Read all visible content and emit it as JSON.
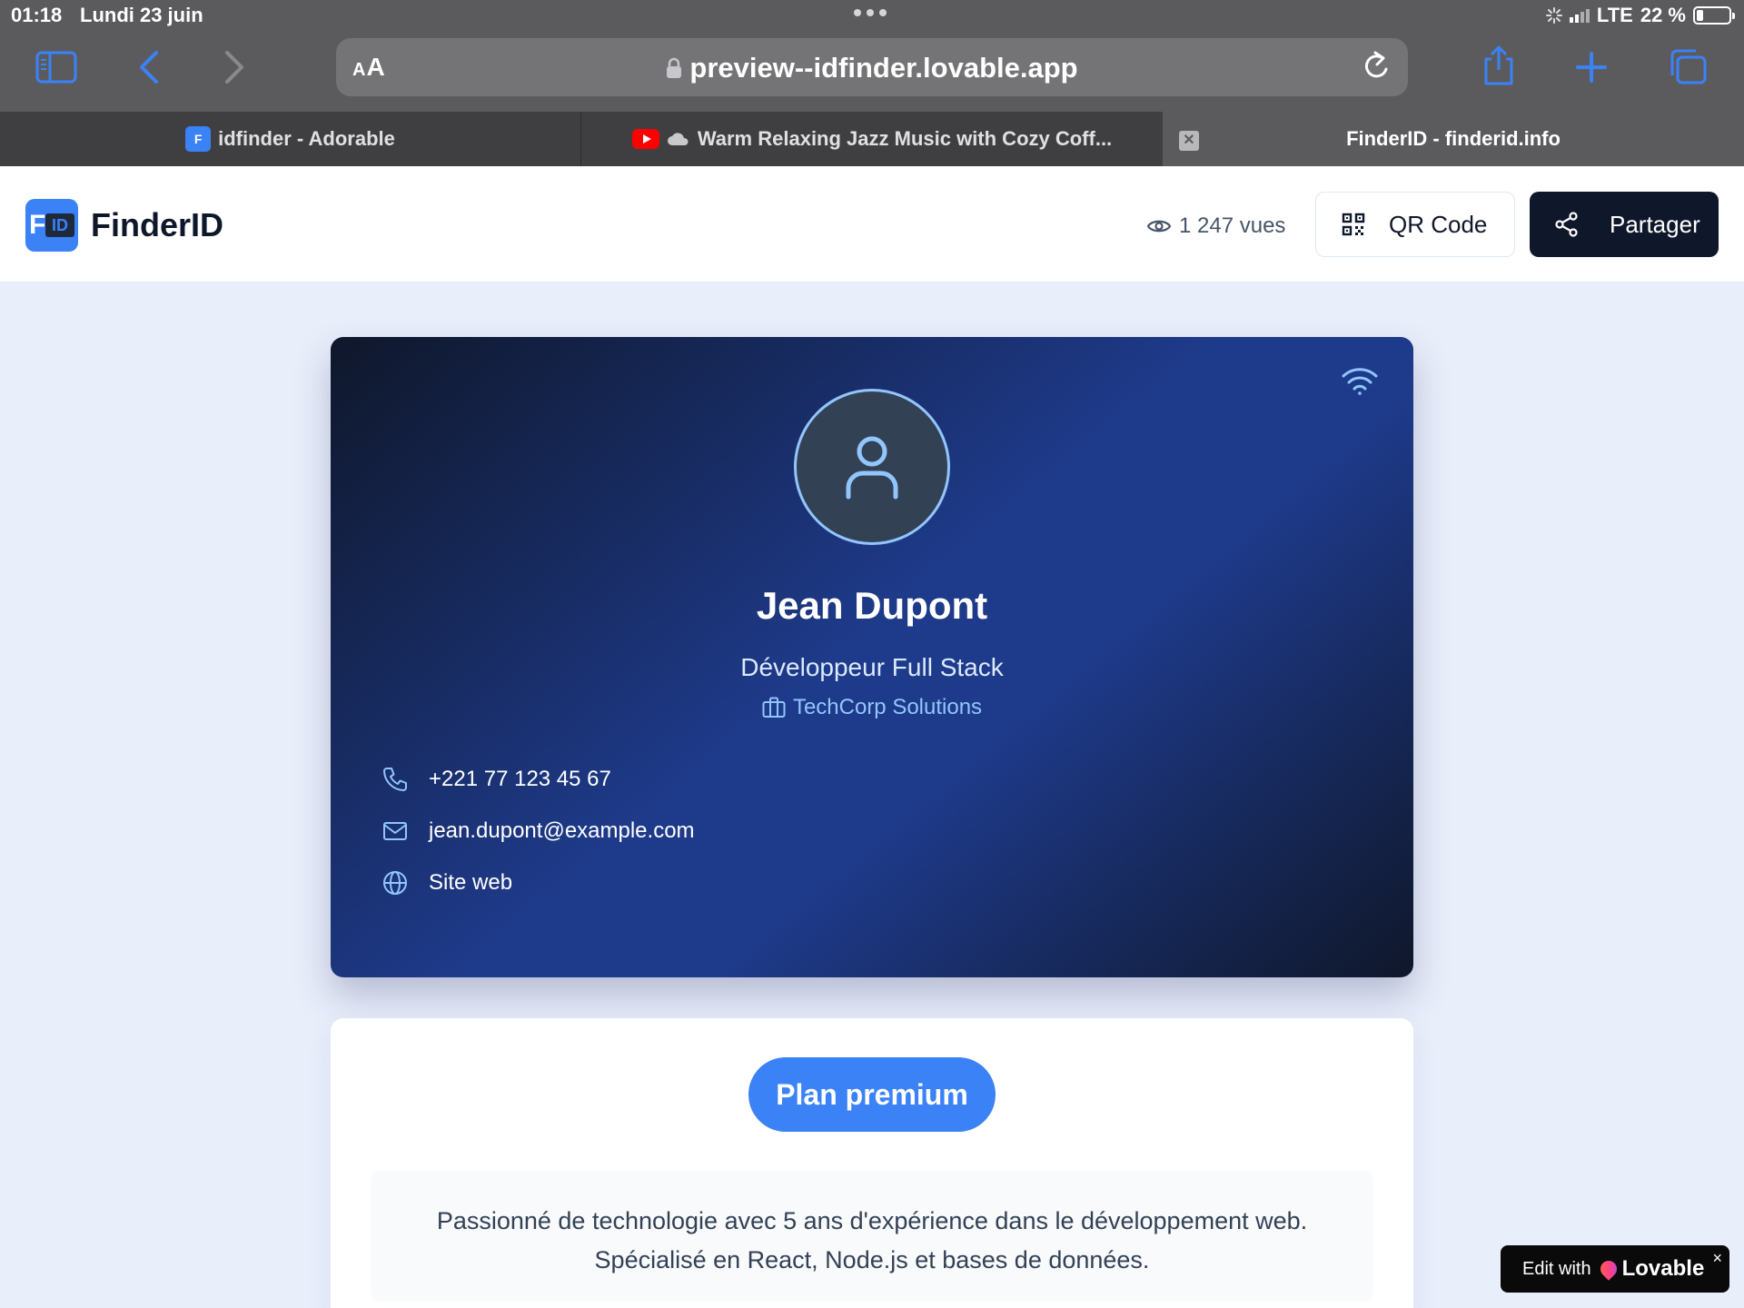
{
  "status_bar": {
    "time": "01:18",
    "date": "Lundi 23 juin",
    "network": "LTE",
    "battery": "22 %"
  },
  "browser": {
    "url_aa_small": "A",
    "url_aa_large": "A",
    "url": "preview--idfinder.lovable.app",
    "tabs": [
      {
        "title": "idfinder - Adorable",
        "favicon": "fd-icon"
      },
      {
        "title": "Warm Relaxing Jazz Music with Cozy Coff...",
        "favicon": "youtube-icon"
      },
      {
        "title": "FinderID - finderid.info",
        "active": true
      }
    ]
  },
  "header": {
    "logo_f": "F",
    "logo_id": "ID",
    "brand": "FinderID",
    "views": "1 247 vues",
    "qr_label": "QR Code",
    "share_label": "Partager"
  },
  "profile": {
    "name": "Jean Dupont",
    "role": "Développeur Full Stack",
    "company": "TechCorp Solutions",
    "contacts": [
      {
        "icon": "phone-icon",
        "text": "+221 77 123 45 67"
      },
      {
        "icon": "mail-icon",
        "text": "jean.dupont@example.com"
      },
      {
        "icon": "globe-icon",
        "text": "Site web"
      }
    ]
  },
  "premium": {
    "plan_label": "Plan premium",
    "bio_line1": "Passionné de technologie avec 5 ans d'expérience dans le développement web.",
    "bio_line2": "Spécialisé en React, Node.js et bases de données."
  },
  "lovable_badge": {
    "prefix": "Edit with",
    "brand": "Lovable",
    "close": "×"
  },
  "colors": {
    "accent": "#3b82f6",
    "dark": "#0f172a",
    "card_mid": "#1e3a8a"
  }
}
